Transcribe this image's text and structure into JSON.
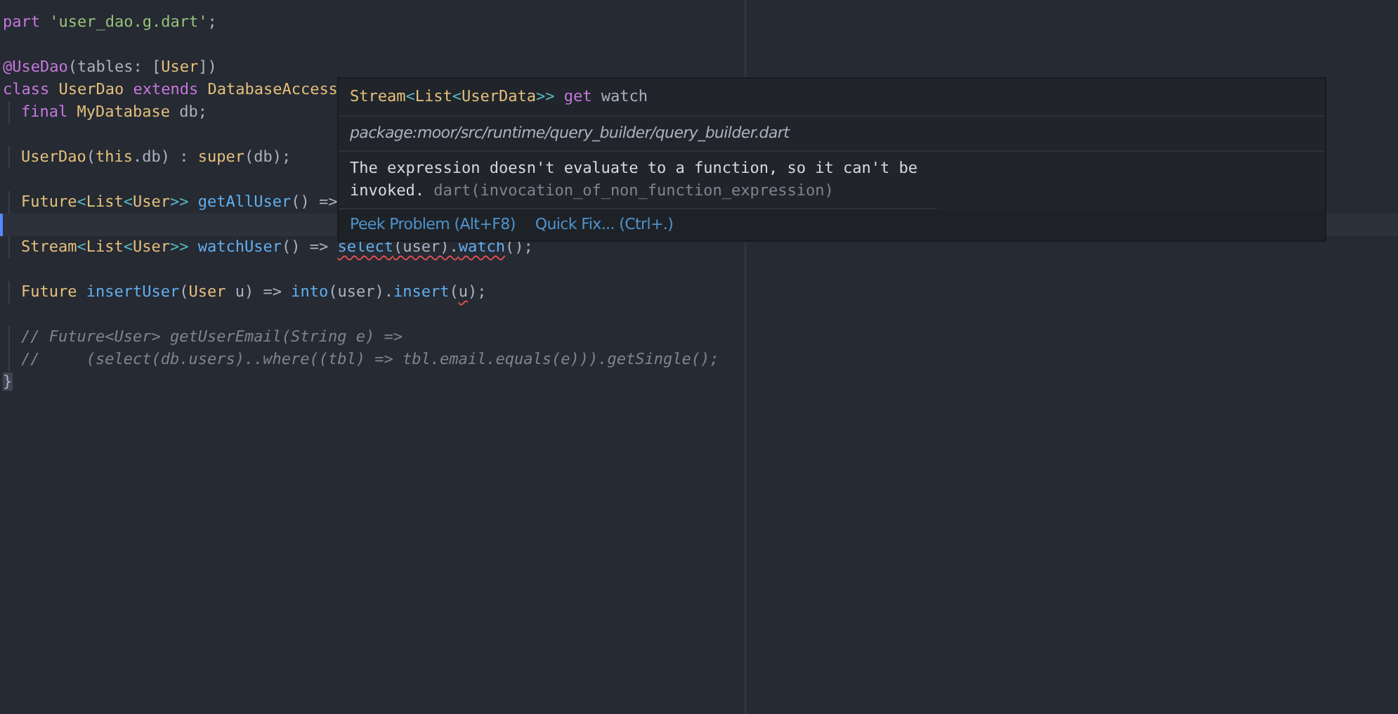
{
  "editor": {
    "lines": [
      {
        "current": false,
        "tokens": [
          {
            "text": "part ",
            "kind": "kw"
          },
          {
            "text": "'user_dao.g.dart'",
            "kind": "str"
          },
          {
            "text": ";",
            "kind": "plain"
          }
        ]
      },
      {
        "current": false
      },
      {
        "current": false,
        "tokens": [
          {
            "text": "@UseDao",
            "kind": "kw"
          },
          {
            "text": "(tables: [",
            "kind": "plain"
          },
          {
            "text": "User",
            "kind": "type"
          },
          {
            "text": "])",
            "kind": "plain"
          }
        ]
      },
      {
        "current": false,
        "tokens": [
          {
            "text": "class ",
            "kind": "kw"
          },
          {
            "text": "UserDao ",
            "kind": "type"
          },
          {
            "text": "extends ",
            "kind": "kw"
          },
          {
            "text": "DatabaseAccess",
            "kind": "type"
          }
        ]
      },
      {
        "current": false,
        "indent": true,
        "tokens": [
          {
            "text": "final ",
            "kind": "kw"
          },
          {
            "text": "MyDatabase ",
            "kind": "type"
          },
          {
            "text": "db;",
            "kind": "plain"
          }
        ]
      },
      {
        "current": false
      },
      {
        "current": false,
        "indent": true,
        "tokens": [
          {
            "text": "UserDao",
            "kind": "type"
          },
          {
            "text": "(",
            "kind": "plain"
          },
          {
            "text": "this",
            "kind": "type"
          },
          {
            "text": ".db) : ",
            "kind": "plain"
          },
          {
            "text": "super",
            "kind": "type"
          },
          {
            "text": "(db);",
            "kind": "plain"
          }
        ]
      },
      {
        "current": false
      },
      {
        "current": false,
        "indent": true,
        "tokens": [
          {
            "text": "Future",
            "kind": "type"
          },
          {
            "text": "<",
            "kind": "angle"
          },
          {
            "text": "List",
            "kind": "type"
          },
          {
            "text": "<",
            "kind": "angle"
          },
          {
            "text": "User",
            "kind": "type"
          },
          {
            "text": ">> ",
            "kind": "angle"
          },
          {
            "text": "getAllUser",
            "kind": "fn"
          },
          {
            "text": "() =>",
            "kind": "plain"
          }
        ]
      },
      {
        "current": true
      },
      {
        "current": false,
        "indent": true,
        "tokens": [
          {
            "text": "Stream",
            "kind": "type"
          },
          {
            "text": "<",
            "kind": "angle"
          },
          {
            "text": "List",
            "kind": "type"
          },
          {
            "text": "<",
            "kind": "angle"
          },
          {
            "text": "User",
            "kind": "type"
          },
          {
            "text": ">> ",
            "kind": "angle"
          },
          {
            "text": "watchUser",
            "kind": "fn"
          },
          {
            "text": "() => ",
            "kind": "plain"
          },
          {
            "text": "select",
            "kind": "fn",
            "err": true
          },
          {
            "text": "(user).",
            "kind": "plain",
            "err": true
          },
          {
            "text": "watch",
            "kind": "fn",
            "err": true
          },
          {
            "text": "();",
            "kind": "plain"
          }
        ]
      },
      {
        "current": false
      },
      {
        "current": false,
        "indent": true,
        "tokens": [
          {
            "text": "Future ",
            "kind": "type"
          },
          {
            "text": "insertUser",
            "kind": "fn"
          },
          {
            "text": "(",
            "kind": "plain"
          },
          {
            "text": "User ",
            "kind": "type"
          },
          {
            "text": "u) => ",
            "kind": "plain"
          },
          {
            "text": "into",
            "kind": "fn"
          },
          {
            "text": "(user).",
            "kind": "plain"
          },
          {
            "text": "insert",
            "kind": "fn"
          },
          {
            "text": "(",
            "kind": "plain"
          },
          {
            "text": "u",
            "kind": "plain",
            "err": true
          },
          {
            "text": ");",
            "kind": "plain"
          }
        ]
      },
      {
        "current": false
      },
      {
        "current": false,
        "indent": true,
        "tokens": [
          {
            "text": "// Future<User> getUserEmail(String e) =>",
            "kind": "comment"
          }
        ]
      },
      {
        "current": false,
        "indent": true,
        "tokens": [
          {
            "text": "//     (select(db.users)..where((tbl) => tbl.email.equals(e))).getSingle();",
            "kind": "comment"
          }
        ]
      },
      {
        "current": false,
        "tokens": [
          {
            "text": "}",
            "kind": "brace"
          }
        ]
      }
    ]
  },
  "hover": {
    "signature": [
      {
        "text": "Stream",
        "kind": "type"
      },
      {
        "text": "<",
        "kind": "angle"
      },
      {
        "text": "List",
        "kind": "type"
      },
      {
        "text": "<",
        "kind": "angle"
      },
      {
        "text": "UserData",
        "kind": "type"
      },
      {
        "text": ">> ",
        "kind": "angle"
      },
      {
        "text": "get ",
        "kind": "kw"
      },
      {
        "text": "watch",
        "kind": "plain"
      }
    ],
    "source": "package:moor/src/runtime/query_builder/query_builder.dart",
    "message": "The expression doesn't evaluate to a function, so it can't be invoked.",
    "code": "dart(invocation_of_non_function_expression)",
    "actions": [
      "Peek Problem (Alt+F8)",
      "Quick Fix... (Ctrl+.)"
    ]
  }
}
